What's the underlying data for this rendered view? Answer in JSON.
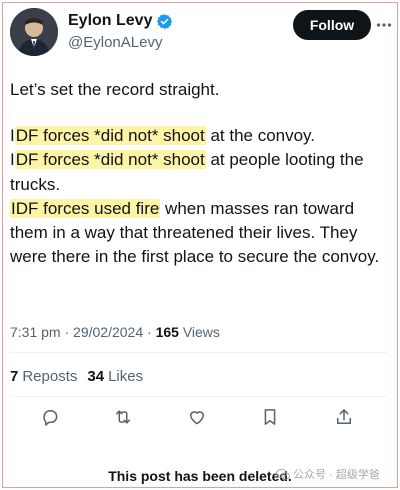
{
  "author": {
    "display_name": "Eylon Levy",
    "handle": "@EylonALevy",
    "verified_icon": "verified-badge-icon",
    "avatar_icon": "avatar-photo"
  },
  "header": {
    "follow_label": "Follow",
    "more_icon": "more-dots-icon"
  },
  "tweet": {
    "line1": "Let’s set the record straight.",
    "p2_hl_a": "I",
    "p2_hl_b": "DF forces *did not* shoot",
    "p2_rest": " at the convoy.",
    "p3_hl_a": "I",
    "p3_hl_b": "DF forces *did not* shoot",
    "p3_rest": " at people looting the trucks.",
    "p4_hl": "IDF forces used fire",
    "p4_rest": " when masses ran toward them in a way that threatened their lives. They were there in the first place to secure the convoy."
  },
  "meta": {
    "time": "7:31 pm",
    "sep": " · ",
    "date": "29/02/2024",
    "views_count": "165",
    "views_label": " Views"
  },
  "stats": {
    "reposts_count": "7",
    "reposts_label": "Reposts",
    "likes_count": "34",
    "likes_label": "Likes"
  },
  "actions": {
    "reply_icon": "reply-icon",
    "repost_icon": "repost-icon",
    "like_icon": "heart-icon",
    "bookmark_icon": "bookmark-icon",
    "share_icon": "share-icon"
  },
  "footer": {
    "deleted_notice": "This post has been deleted.",
    "watermark": "公众号 · 超级学爸"
  },
  "colors": {
    "highlight": "#fdf4a6",
    "verified": "#1d9bf0",
    "text": "#0f1419",
    "secondary": "#536471"
  }
}
